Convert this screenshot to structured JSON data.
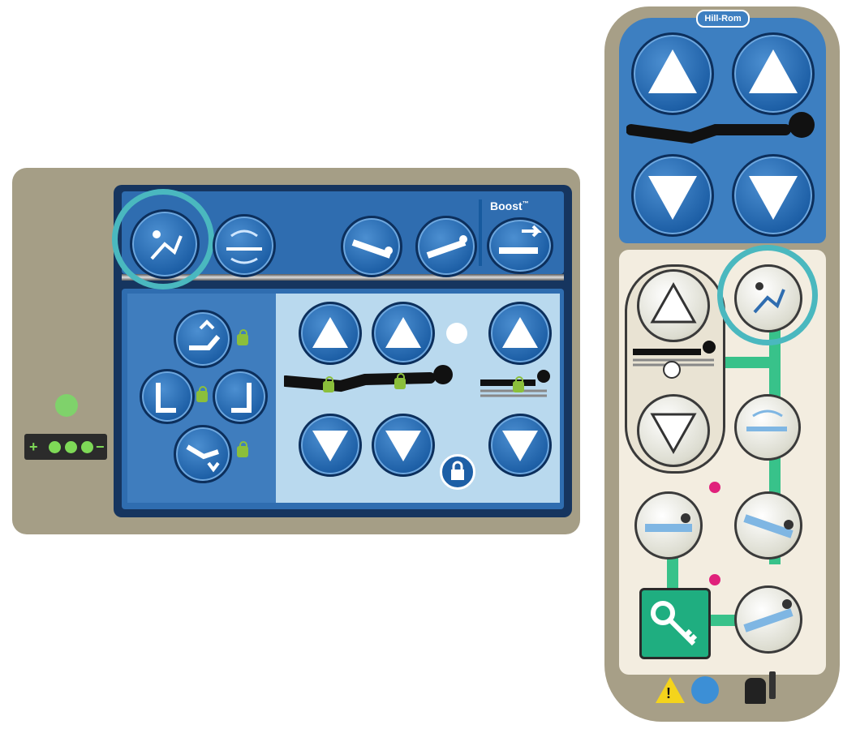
{
  "siderail": {
    "boost_label": "Boost",
    "boost_tm": "™",
    "battery_symbols": [
      "+",
      "−"
    ],
    "top_buttons": [
      "chair-position-icon",
      "turn-assist-icon",
      "trendelenburg-icon",
      "reverse-trendelenburg-icon",
      "boost-icon"
    ],
    "left_buttons": [
      "head-up-icon",
      "knee-lock-icon",
      "foot-lock-icon",
      "knee-down-icon"
    ],
    "arrows": [
      "up-arrow",
      "up-arrow",
      "up-arrow",
      "down-arrow",
      "down-arrow",
      "down-arrow"
    ]
  },
  "pendant": {
    "brand": "Hill-Rom",
    "warning_symbol": "!",
    "colors": {
      "accent": "#4ab8bf",
      "green": "#38c28a",
      "blue": "#3d7fc1",
      "pink": "#e0217b"
    }
  }
}
